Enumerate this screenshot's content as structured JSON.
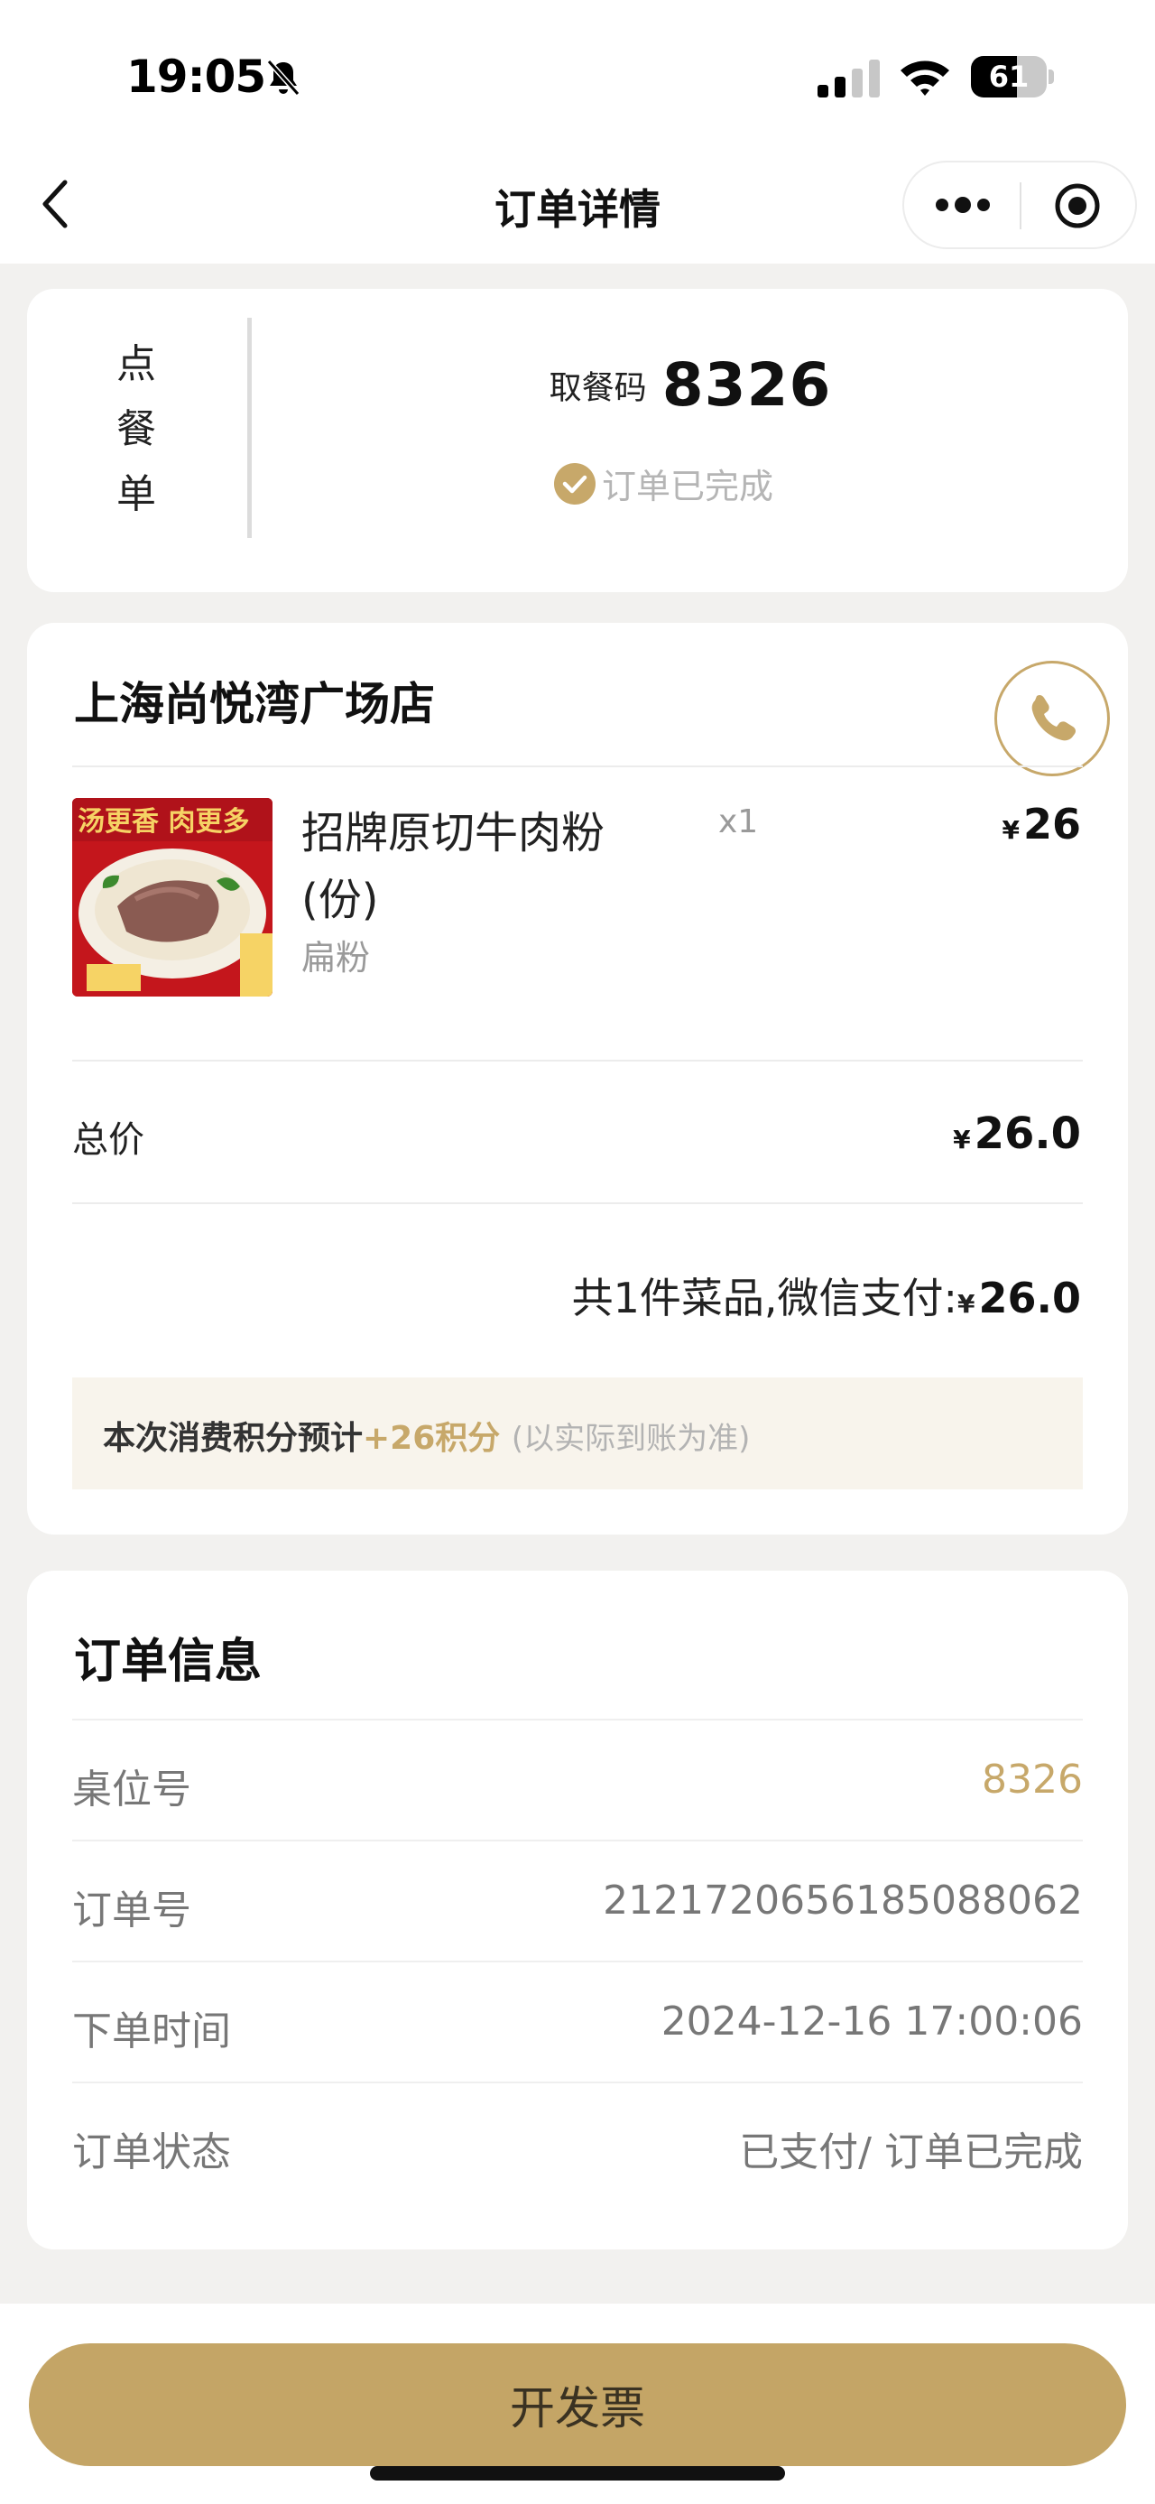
{
  "status_bar": {
    "time": "19:05",
    "battery": "61",
    "battery_level": 0.61
  },
  "nav": {
    "title": "订单详情"
  },
  "order_card": {
    "type_chars": [
      "点",
      "餐",
      "单"
    ],
    "pickup_label": "取餐码",
    "pickup_code": "8326",
    "status": "订单已完成"
  },
  "store": {
    "name": "上海尚悦湾广场店",
    "item": {
      "name": "招牌原切牛肉粉(份)",
      "spec": "扁粉",
      "qty": "x1",
      "currency": "¥",
      "price": "26"
    },
    "total_label": "总价",
    "total_value": "26.0",
    "summary_prefix": "共1件菜品,微信支付:",
    "summary_amount": "26.0",
    "points_prefix": "本次消费积分预计",
    "points_value": "+26积分",
    "points_note": "(以实际到账为准)"
  },
  "order_info": {
    "title": "订单信息",
    "rows": [
      {
        "label": "桌位号",
        "value": "8326"
      },
      {
        "label": "订单号",
        "value": "2121720656185088062"
      },
      {
        "label": "下单时间",
        "value": "2024-12-16 17:00:06"
      },
      {
        "label": "订单状态",
        "value": "已支付/ 订单已完成"
      }
    ]
  },
  "footer": {
    "invoice_button": "开发票"
  },
  "colors": {
    "accent": "#c7a86a",
    "button": "#c4a566",
    "background": "#f2f1ef"
  }
}
